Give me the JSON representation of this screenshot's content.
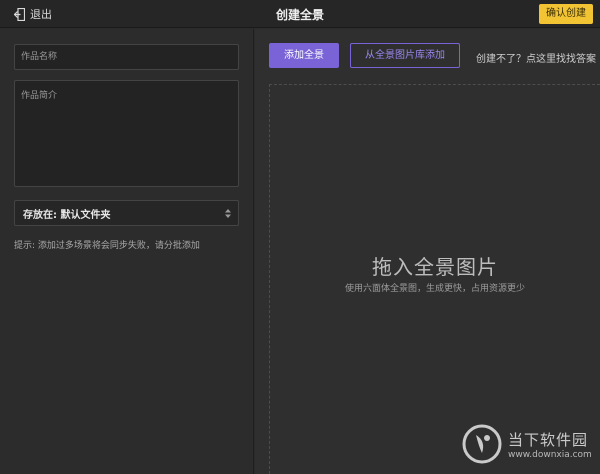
{
  "header": {
    "exit_label": "退出",
    "title": "创建全景",
    "confirm_label": "确认创建"
  },
  "left_panel": {
    "name_placeholder": "作品名称",
    "description_placeholder": "作品简介",
    "folder_select": "存放在: 默认文件夹",
    "hint": "提示: 添加过多场景将会同步失败，请分批添加"
  },
  "right_panel": {
    "add_button": "添加全景",
    "library_button": "从全景图片库添加",
    "help_link": "创建不了？点这里找找答案",
    "drop_title": "拖入全景图片",
    "drop_subtitle": "使用六面体全景图，生成更快，占用资源更少"
  },
  "watermark": {
    "cn": "当下软件园",
    "en": "www.downxia.com"
  },
  "colors": {
    "accent_purple": "#7a63d6",
    "confirm_yellow": "#f2c434",
    "background": "#2b2b2b"
  }
}
